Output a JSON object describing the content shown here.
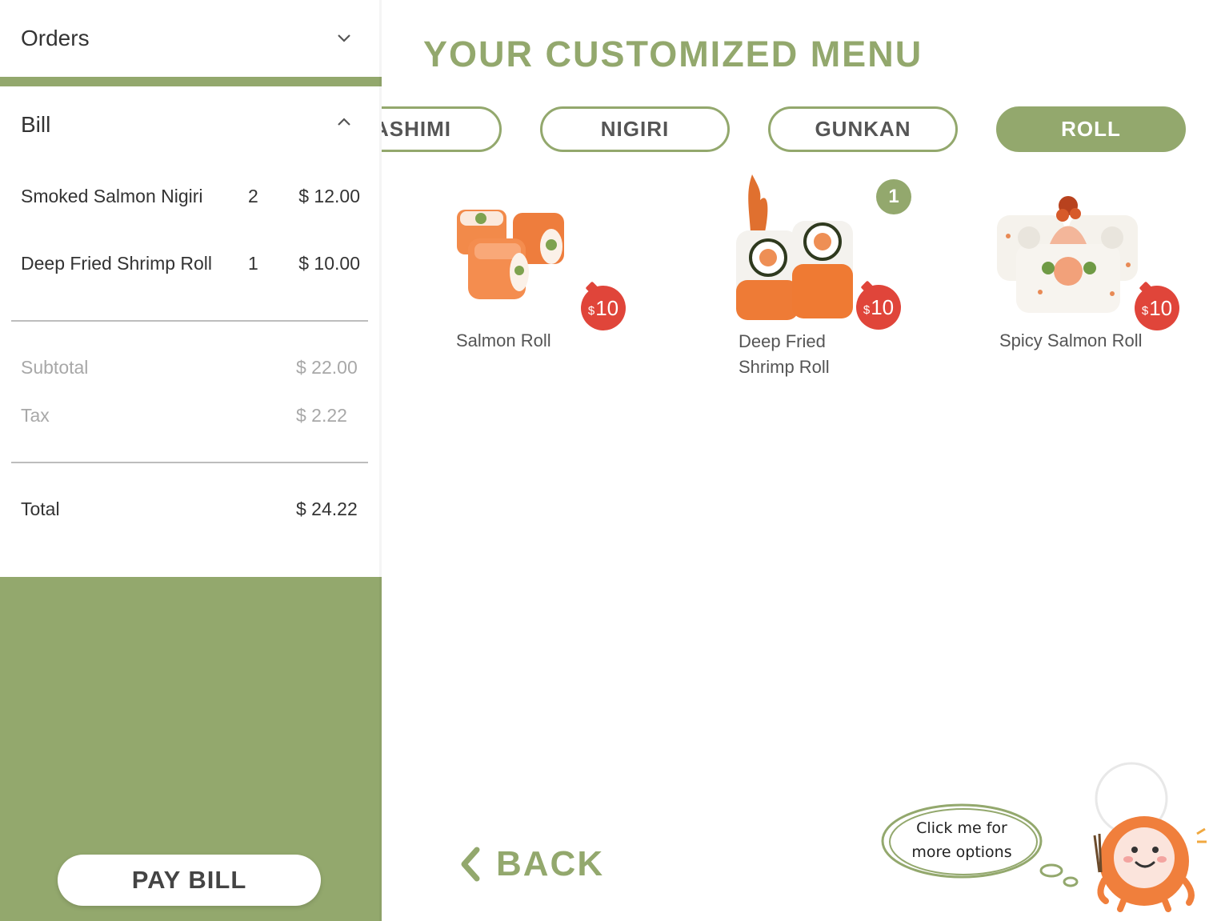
{
  "sidebar": {
    "orders_title": "Orders",
    "bill_title": "Bill",
    "items": [
      {
        "name": "Smoked Salmon Nigiri",
        "qty": "2",
        "price": "$ 12.00"
      },
      {
        "name": "Deep Fried Shrimp Roll",
        "qty": "1",
        "price": "$ 10.00"
      }
    ],
    "subtotal_label": "Subtotal",
    "subtotal_value": "$ 22.00",
    "tax_label": "Tax",
    "tax_value": "$ 2.22",
    "total_label": "Total",
    "total_value": "$ 24.22",
    "pay_bill_label": "PAY BILL"
  },
  "main": {
    "title": "YOUR CUSTOMIZED MENU",
    "tabs": [
      {
        "label": "SASHIMI",
        "visible_text": "ASHIMI",
        "selected": false
      },
      {
        "label": "NIGIRI",
        "selected": false
      },
      {
        "label": "GUNKAN",
        "selected": false
      },
      {
        "label": "ROLL",
        "selected": true
      }
    ],
    "menu_items": [
      {
        "name": "Salmon Roll",
        "currency": "$",
        "price": "10"
      },
      {
        "name_line1": "Deep Fried",
        "name_line2": "Shrimp Roll",
        "currency": "$",
        "price": "10",
        "count": "1"
      },
      {
        "name": "Spicy Salmon Roll",
        "currency": "$",
        "price": "10"
      }
    ],
    "back_label": "BACK",
    "bubble_line1": "Click me for",
    "bubble_line2": "more options"
  },
  "colors": {
    "accent_green": "#93a86d",
    "price_red": "#e0453a",
    "salmon_orange": "#f08a4b"
  }
}
